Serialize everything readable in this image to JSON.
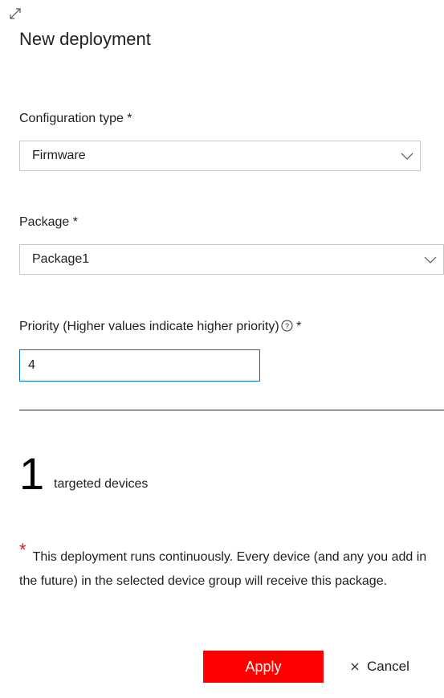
{
  "panel": {
    "title": "New deployment"
  },
  "form": {
    "config_type": {
      "label": "Configuration type *",
      "value": "Firmware"
    },
    "package": {
      "label": "Package *",
      "value": "Package1"
    },
    "priority": {
      "label": "Priority (Higher values indicate higher priority)",
      "required_marker": " *",
      "value": "4"
    }
  },
  "summary": {
    "count": "1",
    "count_label": "targeted devices"
  },
  "note": {
    "marker": "*",
    "text": "This deployment runs continuously. Every device (and any you add in the future) in the selected device group will receive this package."
  },
  "actions": {
    "apply_label": "Apply",
    "cancel_label": "Cancel"
  },
  "icons": {
    "expand": "expand-icon",
    "dropdown": "chevron-down-icon",
    "help": "help-circle-icon",
    "close": "close-icon"
  },
  "colors": {
    "primary_button": "#ff0000",
    "required_marker": "#e81123",
    "input_focus_border": "#0f6cbd"
  }
}
